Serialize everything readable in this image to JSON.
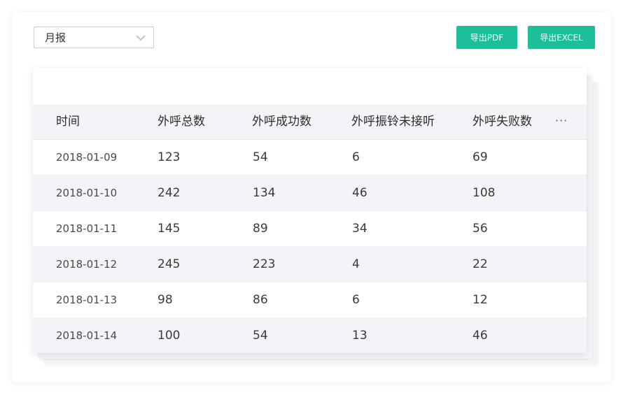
{
  "period_select": {
    "value": "月报",
    "icon": "chevron-down-icon"
  },
  "toolbar": {
    "export_pdf_label": "导出PDF",
    "export_excel_label": "导出EXCEL",
    "accent_color": "#1cbf99"
  },
  "table": {
    "headers": [
      "时间",
      "外呼总数",
      "外呼成功数",
      "外呼振铃未接听",
      "外呼失败数"
    ],
    "more_label": "···",
    "rows": [
      {
        "date": "2018-01-09",
        "total": "123",
        "success": "54",
        "ring_no_answer": "6",
        "failed": "69"
      },
      {
        "date": "2018-01-10",
        "total": "242",
        "success": "134",
        "ring_no_answer": "46",
        "failed": "108"
      },
      {
        "date": "2018-01-11",
        "total": "145",
        "success": "89",
        "ring_no_answer": "34",
        "failed": "56"
      },
      {
        "date": "2018-01-12",
        "total": "245",
        "success": "223",
        "ring_no_answer": "4",
        "failed": "22"
      },
      {
        "date": "2018-01-13",
        "total": "98",
        "success": "86",
        "ring_no_answer": "6",
        "failed": "12"
      },
      {
        "date": "2018-01-14",
        "total": "100",
        "success": "54",
        "ring_no_answer": "13",
        "failed": "46"
      }
    ]
  }
}
